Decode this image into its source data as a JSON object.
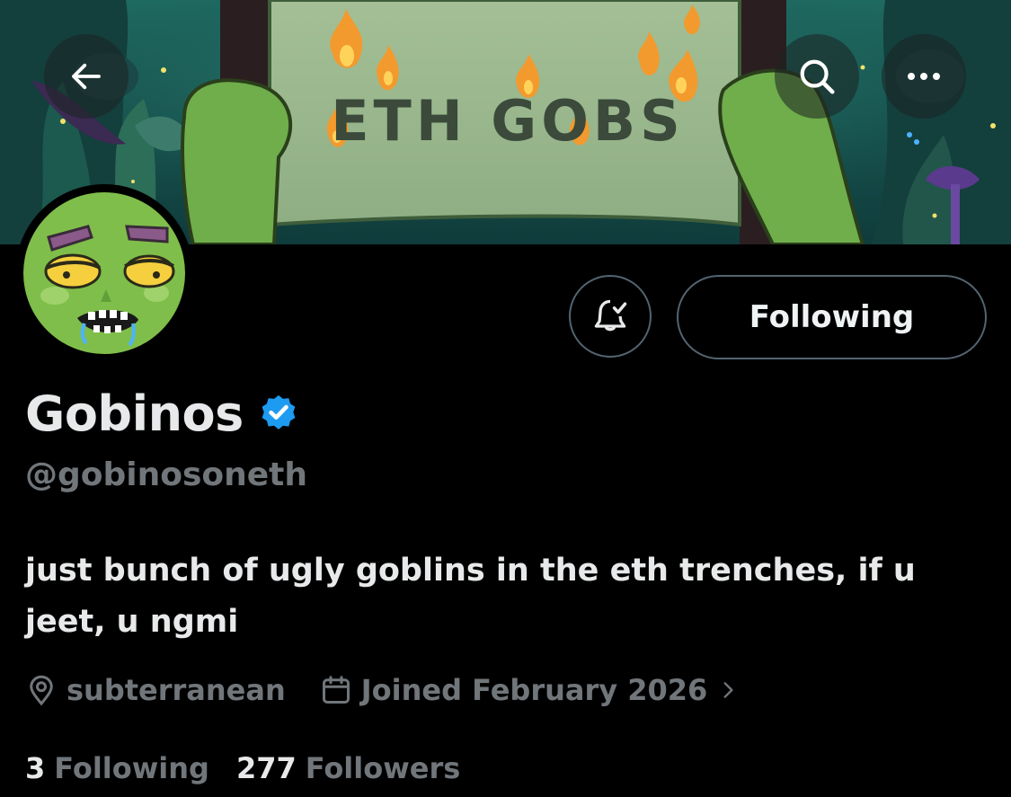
{
  "header": {
    "banner_text": "ETH GOBS",
    "back_icon": "arrow-left-icon",
    "search_icon": "search-icon",
    "more_icon": "more-horizontal-icon"
  },
  "actions": {
    "notify_icon": "bell-check-icon",
    "following_label": "Following"
  },
  "profile": {
    "name": "Gobinos",
    "verified_icon": "verified-badge-icon",
    "handle": "@gobinosoneth",
    "bio": "just bunch of ugly goblins in the eth trenches, if u jeet, u ngmi",
    "location": "subterranean",
    "location_icon": "location-pin-icon",
    "joined": "Joined February 2026",
    "joined_icon": "calendar-icon",
    "joined_chevron_icon": "chevron-right-icon"
  },
  "stats": {
    "following_count": "3",
    "following_label": "Following",
    "followers_count": "277",
    "followers_label": "Followers"
  },
  "colors": {
    "background": "#000000",
    "text_primary": "#e7e9ea",
    "text_secondary": "#71767b",
    "border": "#536471",
    "verified_blue": "#1d9bf0"
  }
}
